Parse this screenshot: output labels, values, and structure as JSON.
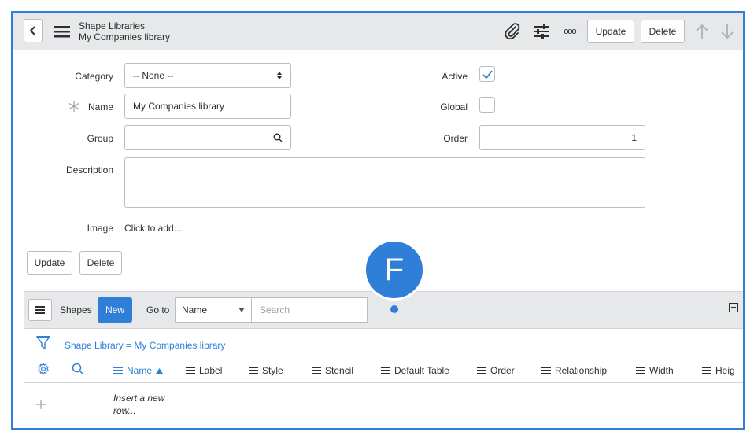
{
  "header": {
    "title": "Shape Libraries",
    "subtitle": "My Companies library",
    "update_label": "Update",
    "delete_label": "Delete",
    "more_label": "ooo"
  },
  "form": {
    "category": {
      "label": "Category",
      "value": "-- None --"
    },
    "name": {
      "label": "Name",
      "value": "My Companies library"
    },
    "group": {
      "label": "Group",
      "value": ""
    },
    "description": {
      "label": "Description",
      "value": ""
    },
    "image": {
      "label": "Image",
      "value": "Click to add..."
    },
    "active": {
      "label": "Active",
      "checked": true
    },
    "global": {
      "label": "Global",
      "checked": false
    },
    "order": {
      "label": "Order",
      "value": "1"
    },
    "update_label": "Update",
    "delete_label": "Delete"
  },
  "marker": {
    "letter": "F",
    "color": "#2f7fd8"
  },
  "list": {
    "title": "Shapes",
    "new_label": "New",
    "goto_label": "Go to",
    "goto_select": "Name",
    "search_placeholder": "Search",
    "filter_text": "Shape Library = My Companies library",
    "columns": [
      "Name",
      "Label",
      "Style",
      "Stencil",
      "Default Table",
      "Order",
      "Relationship",
      "Width",
      "Heig"
    ],
    "sorted_column": "Name",
    "insert_row_line1": "Insert a new",
    "insert_row_line2": "row..."
  },
  "colors": {
    "accent": "#2f7fd8",
    "header_bg": "#e6e8ea",
    "border": "#b8bec4"
  }
}
